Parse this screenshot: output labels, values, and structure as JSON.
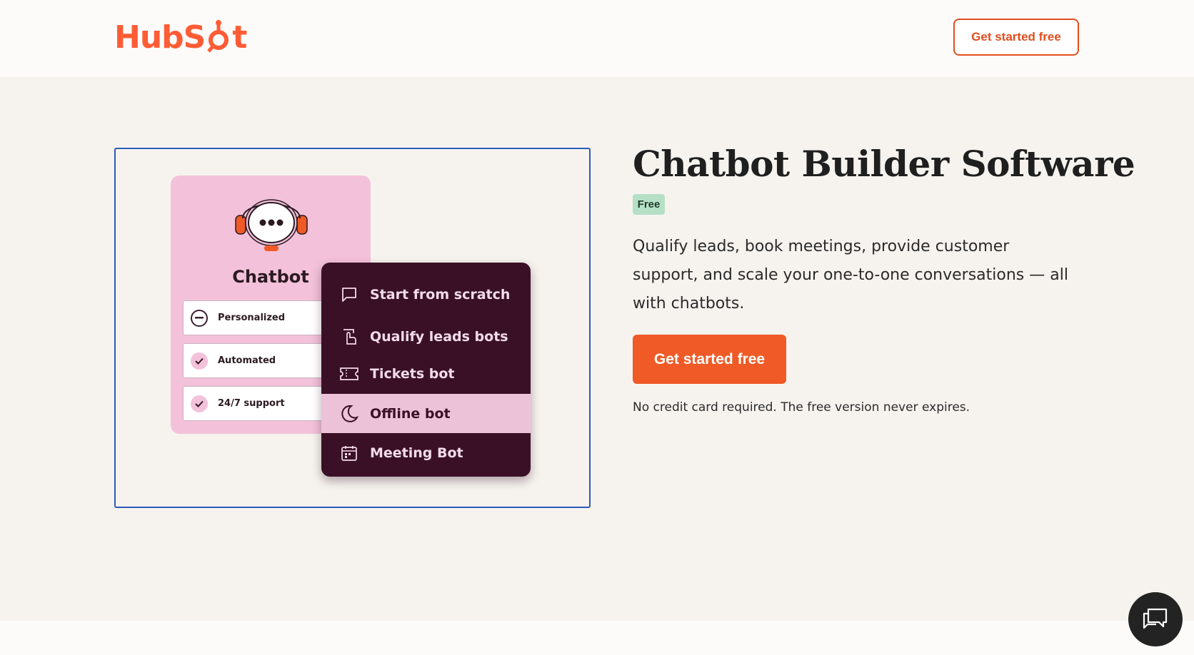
{
  "header": {
    "logo_text_left": "HubS",
    "logo_text_right": "t",
    "cta_label": "Get started free"
  },
  "illustration": {
    "card_title": "Chatbot",
    "features": [
      {
        "label": "Personalized",
        "icon": "minus-circle-icon"
      },
      {
        "label": "Automated",
        "icon": "check-icon"
      },
      {
        "label": "24/7 support",
        "icon": "check-icon"
      }
    ],
    "menu": [
      {
        "label": "Start from scratch",
        "icon": "speech-bubble-icon",
        "active": false
      },
      {
        "label": "Qualify leads bots",
        "icon": "hand-pointer-icon",
        "active": false
      },
      {
        "label": "Tickets bot",
        "icon": "ticket-icon",
        "active": false
      },
      {
        "label": "Offline bot",
        "icon": "moon-icon",
        "active": true
      },
      {
        "label": "Meeting Bot",
        "icon": "calendar-icon",
        "active": false
      }
    ]
  },
  "hero": {
    "title": "Chatbot Builder Software",
    "badge": "Free",
    "description": "Qualify leads, book meetings, provide customer support, and scale your one-to-one conversations — all with chatbots.",
    "cta_label": "Get started free",
    "note": "No credit card required. The free version never expires."
  },
  "colors": {
    "brand": "#ff5c35",
    "cta": "#ef5a26",
    "menu_bg": "#3a1026",
    "card_pink": "#f3c2da",
    "badge_green": "#b6e0c6"
  }
}
